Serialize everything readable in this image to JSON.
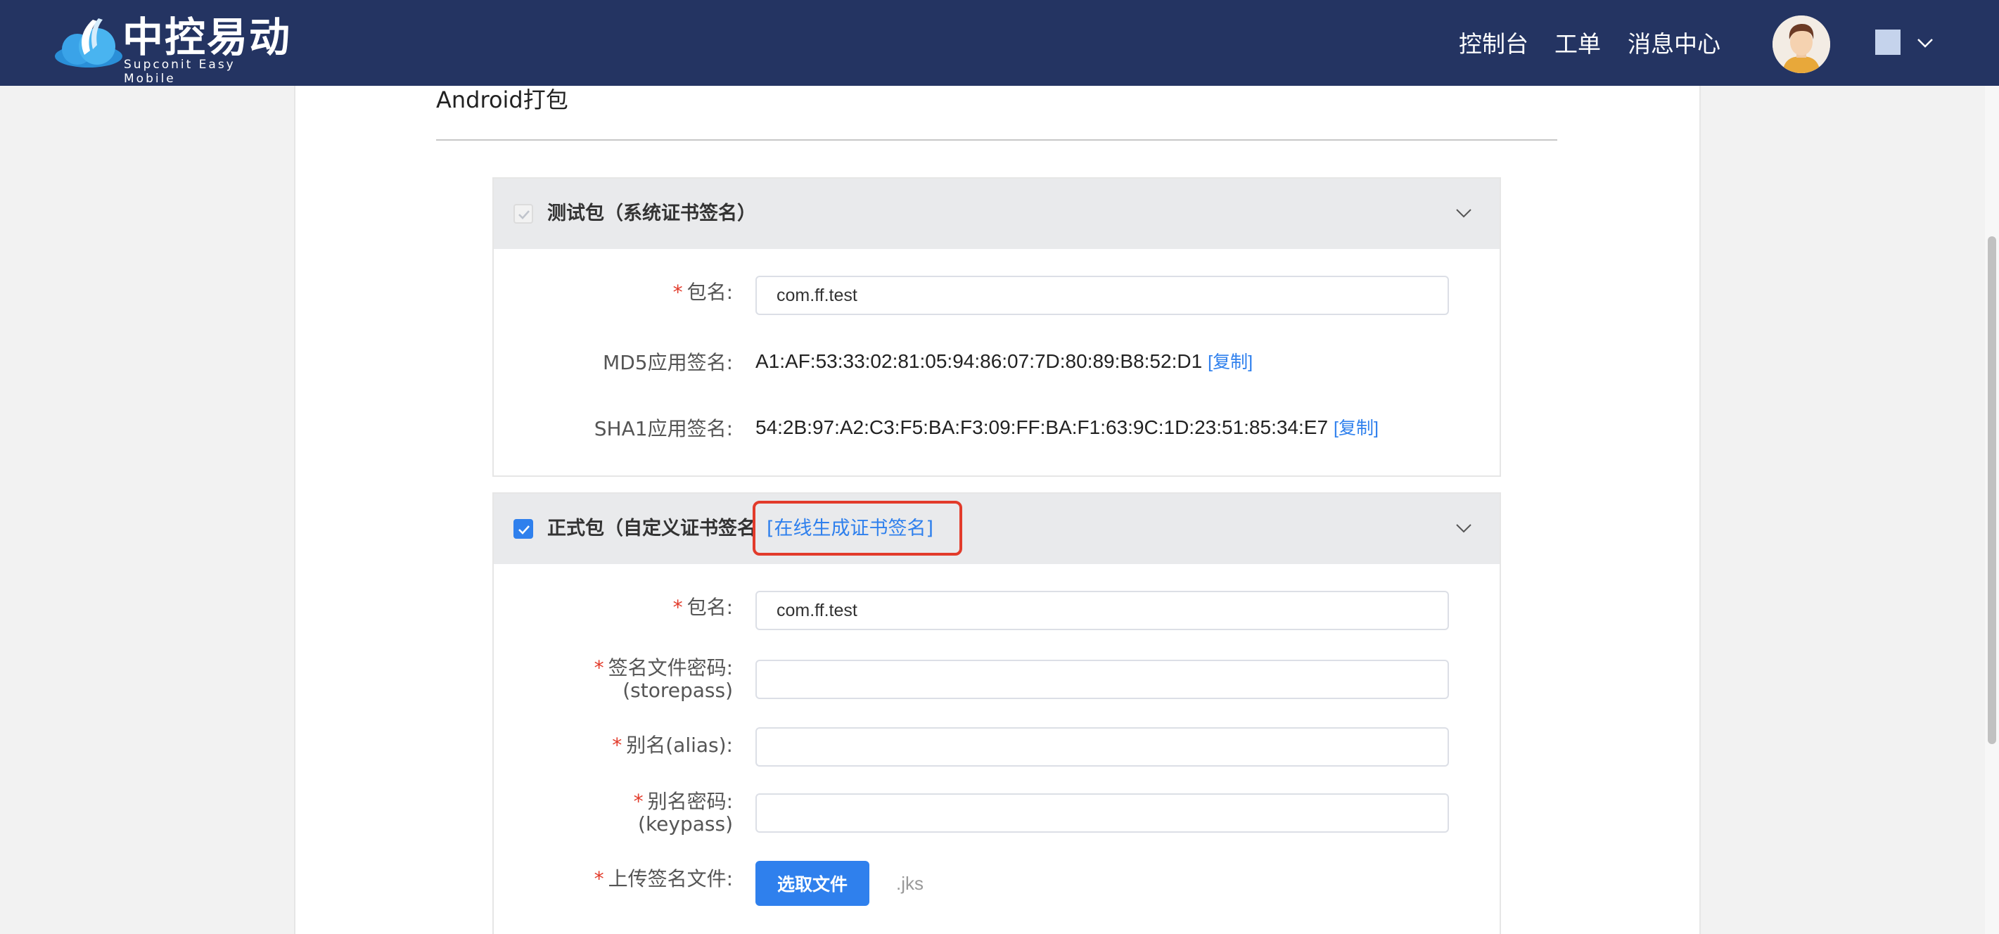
{
  "header": {
    "logo_cn": "中控易动",
    "logo_en": "Supconit Easy Mobile",
    "nav": [
      "控制台",
      "工单",
      "消息中心"
    ],
    "brand_color": "#243462"
  },
  "page": {
    "title": "Android打包"
  },
  "test_package": {
    "title": "测试包（系统证书签名）",
    "checked": true,
    "disabled": true,
    "package_label": "包名:",
    "package_value": "com.ff.test",
    "md5_label": "MD5应用签名:",
    "md5_value": "A1:AF:53:33:02:81:05:94:86:07:7D:80:89:B8:52:D1",
    "sha1_label": "SHA1应用签名:",
    "sha1_value": "54:2B:97:A2:C3:F5:BA:F3:09:FF:BA:F1:63:9C:1D:23:51:85:34:E7",
    "copy_label": "[复制]"
  },
  "release_package": {
    "title": "正式包（自定义证书签名",
    "generate_link": "[在线生成证书签名]",
    "checked": true,
    "package_label": "包名:",
    "package_value": "com.ff.test",
    "storepass_label": "签名文件密码:",
    "storepass_sub": "(storepass)",
    "alias_label": "别名(alias):",
    "keypass_label": "别名密码:",
    "keypass_sub": "(keypass)",
    "upload_label": "上传签名文件:",
    "upload_button": "选取文件",
    "upload_hint": ".jks"
  },
  "required_mark": "*",
  "accent_color": "#2f80ed",
  "highlight_color": "#e23b2b"
}
